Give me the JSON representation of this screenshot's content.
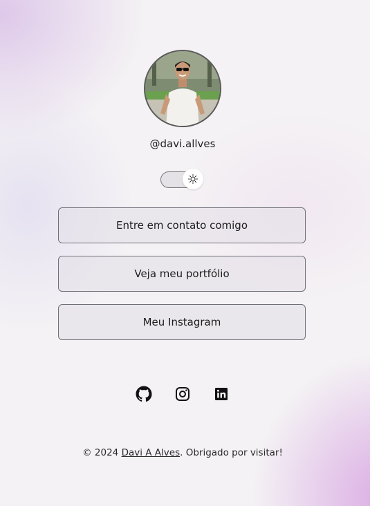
{
  "profile": {
    "username": "@davi.allves"
  },
  "theme_toggle": {
    "icon": "sun-icon",
    "state": "light"
  },
  "links": [
    {
      "label": "Entre em contato comigo"
    },
    {
      "label": "Veja meu portfólio"
    },
    {
      "label": "Meu Instagram"
    }
  ],
  "socials": [
    {
      "icon": "github-icon"
    },
    {
      "icon": "instagram-icon"
    },
    {
      "icon": "linkedin-icon"
    }
  ],
  "footer": {
    "prefix": "© 2024 ",
    "author_link": "Davi A Alves",
    "suffix": ". Obrigado por visitar!"
  }
}
